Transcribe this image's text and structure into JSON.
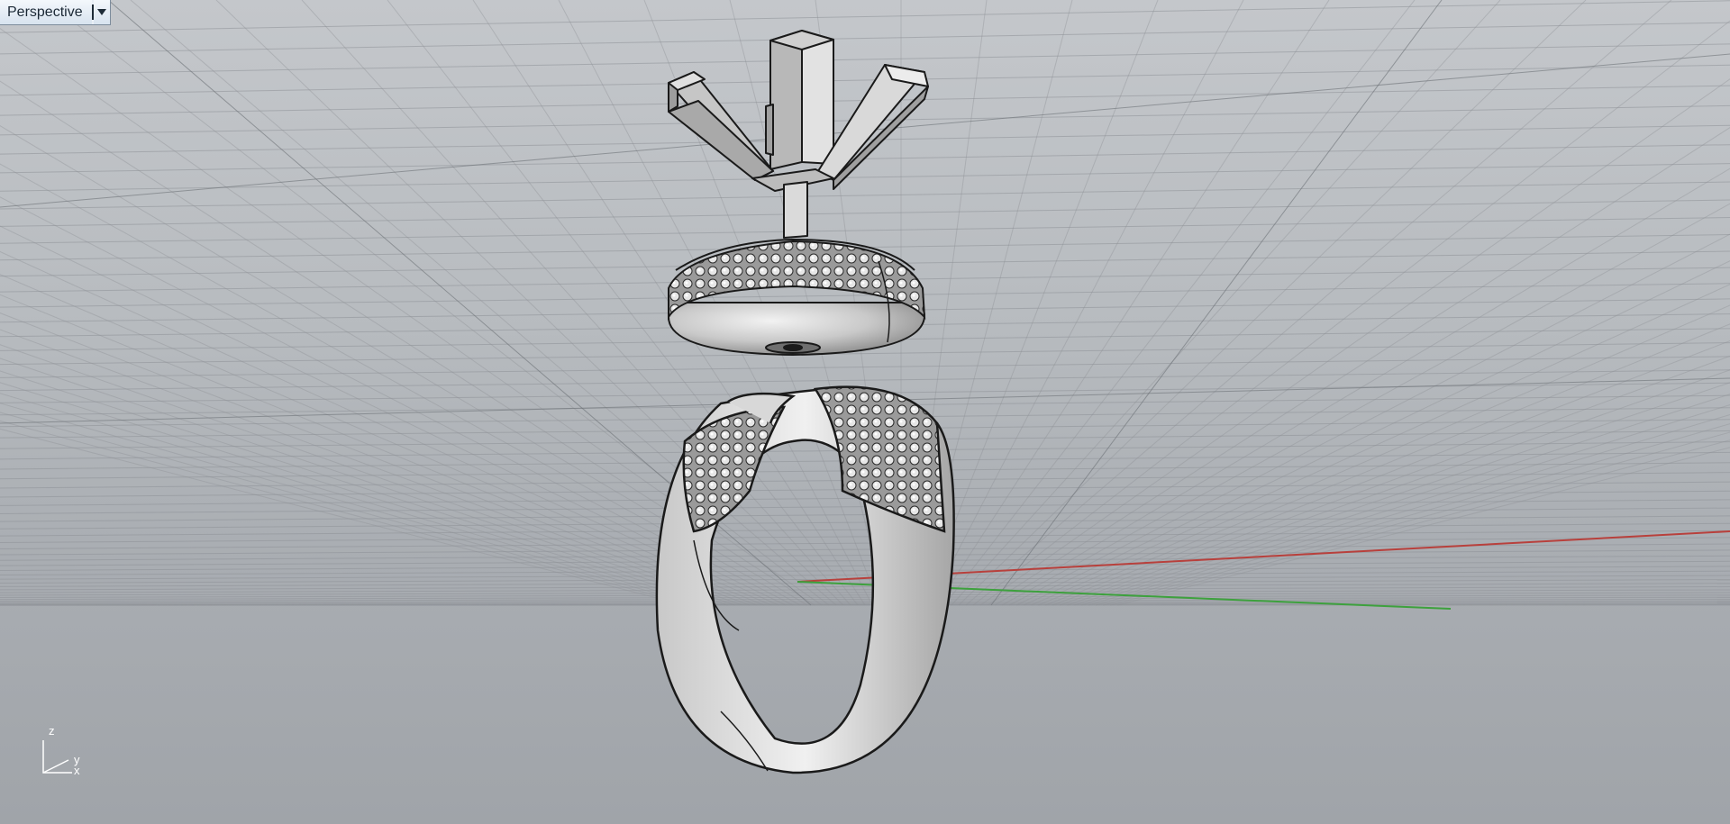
{
  "viewport": {
    "title": "Perspective",
    "dropdown_icon": "caret-down-icon",
    "background_top": "#c4c7cb",
    "background_bottom": "#a0a4a9",
    "grid_color": "#8e9297",
    "x_axis_color": "#b8403c",
    "y_axis_color": "#3da13d"
  },
  "axis_widget": {
    "z_label": "z",
    "y_label": "y",
    "x_label": "x"
  },
  "model": {
    "parts": [
      "prong-head",
      "halo-cup",
      "pave-ring-shank"
    ]
  }
}
